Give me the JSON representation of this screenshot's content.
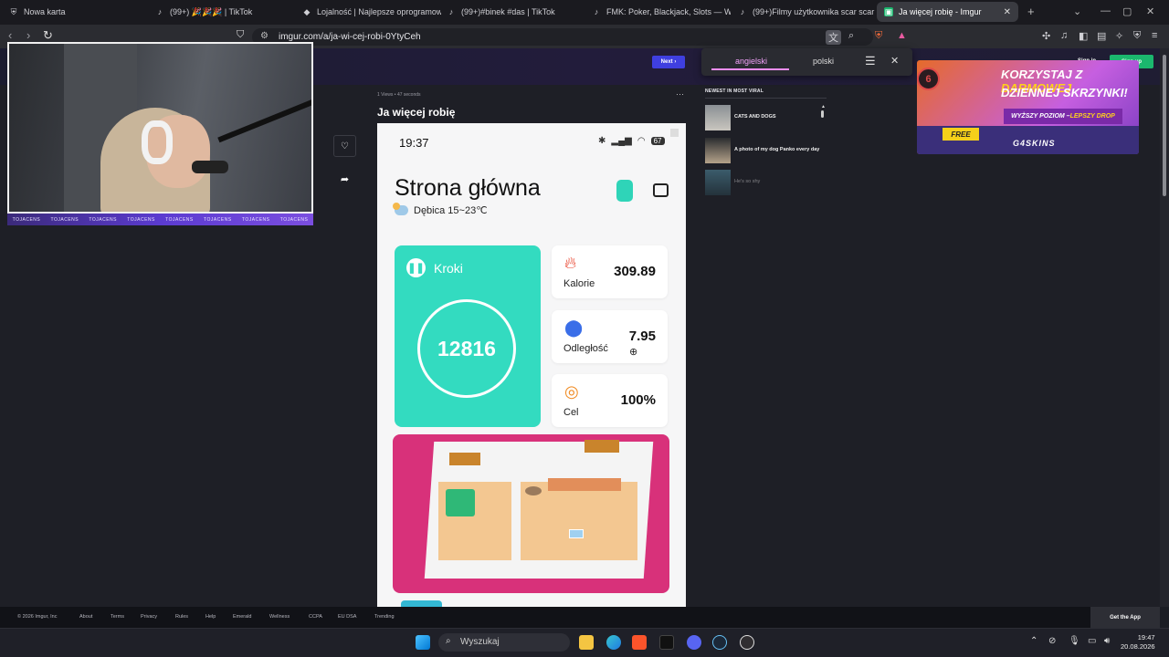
{
  "browser": {
    "tabs": [
      {
        "title": "Nowa karta",
        "icon": "shield-icon"
      },
      {
        "title": "(99+) 🎉🎉🎉 | TikTok",
        "icon": "tiktok-icon"
      },
      {
        "title": "Lojalność | Najlepsze oprogramowa",
        "icon": "gem-icon"
      },
      {
        "title": "(99+)#binek #das | TikTok",
        "icon": "tiktok-icon"
      },
      {
        "title": "FMK: Poker, Blackjack, Slots — Whe",
        "icon": "tiktok-icon"
      },
      {
        "title": "(99+)Filmy użytkownika scar scar (@",
        "icon": "tiktok-icon"
      },
      {
        "title": "Ja więcej robię - Imgur",
        "icon": "imgur-icon",
        "active": true
      }
    ],
    "url": "imgur.com/a/ja-wi-cej-robi-0YtyCeh"
  },
  "stream": {
    "overlay_text": "TOJACENS"
  },
  "translate": {
    "lang_from": "angielski",
    "lang_to": "polski"
  },
  "post": {
    "meta": "1 Views • 47 seconds",
    "title": "Ja więcej robię",
    "next_label": "Next"
  },
  "phone": {
    "time": "19:37",
    "battery": "67",
    "title": "Strona główna",
    "weather": "Dębica 15~23℃",
    "steps_label": "Kroki",
    "steps_value": "12816",
    "cards": [
      {
        "label": "Kalorie",
        "value": "309.89",
        "icon": "flame-icon",
        "color": "#e8402a"
      },
      {
        "label": "Odległość",
        "value": "7.95",
        "icon": "location-pin-icon",
        "color": "#3a6ee8"
      },
      {
        "label": "Cel",
        "value": "100%",
        "icon": "target-icon",
        "color": "#f08a20"
      }
    ]
  },
  "sidebar": {
    "heading": "NEWEST IN MOST VIRAL",
    "items": [
      {
        "title": "CATS AND DOGS"
      },
      {
        "title": "A photo of my dog Panko every day"
      },
      {
        "title": "He's so shy"
      }
    ]
  },
  "ad": {
    "badge": "6",
    "line1_a": "KORZYSTAJ Z ",
    "line1_b": "DARMOWEJ",
    "line2": "DZIENNEJ SKRZYNKI!",
    "level_a": "WYŻSZY POZIOM – ",
    "level_b": "LEPSZY DROP",
    "free": "FREE",
    "brand": "G4SKINS"
  },
  "auth": {
    "signin": "Sign in",
    "signup": "Sign up"
  },
  "footer": {
    "links": [
      "© 2026 Imgur, Inc",
      "About",
      "Terms",
      "Privacy",
      "Rules",
      "Help",
      "Emerald",
      "Wellness",
      "CCPA",
      "EU DSA",
      "Trending"
    ],
    "get_app": "Get the App"
  },
  "taskbar": {
    "search_placeholder": "Wyszukaj",
    "time": "19:47",
    "date": "20.08.2026"
  },
  "colors": {
    "accent": "#33dbc0",
    "pink": "#d8317a",
    "imgur_green": "#1bb76e"
  }
}
